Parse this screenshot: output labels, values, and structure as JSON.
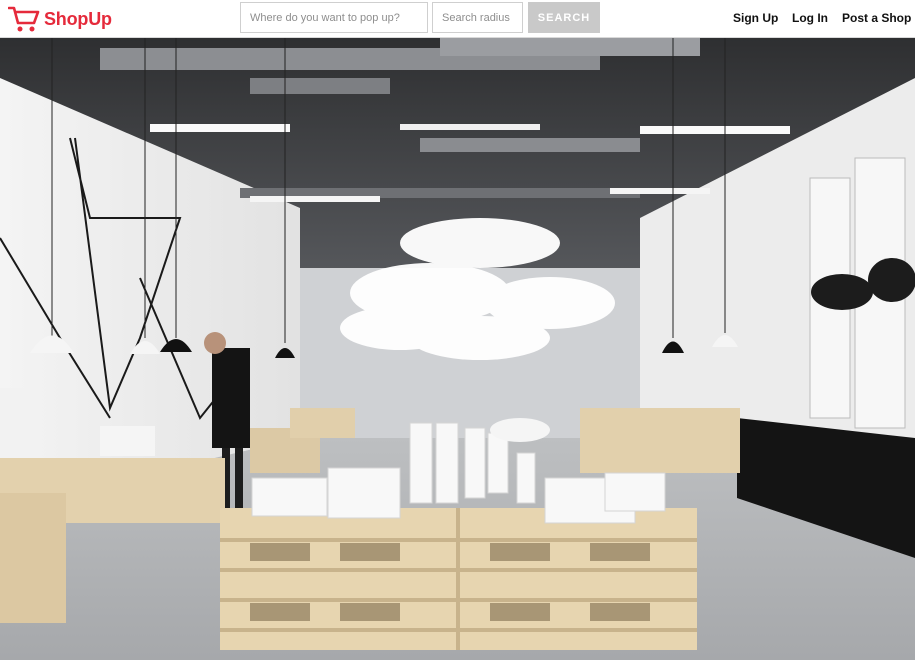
{
  "brand": {
    "name": "ShopUp",
    "color": "#e52a3b",
    "icon": "shopping-cart-icon"
  },
  "search": {
    "location_placeholder": "Where do you want to pop up?",
    "radius_placeholder": "Search radius",
    "button_label": "SEARCH"
  },
  "nav": {
    "sign_up": "Sign Up",
    "log_in": "Log In",
    "post_shop": "Post a Shop"
  },
  "hero": {
    "image_description": "Photograph of an industrial pop-up store interior with wooden pallet displays, white hanging cloud lamps and a man browsing products"
  }
}
